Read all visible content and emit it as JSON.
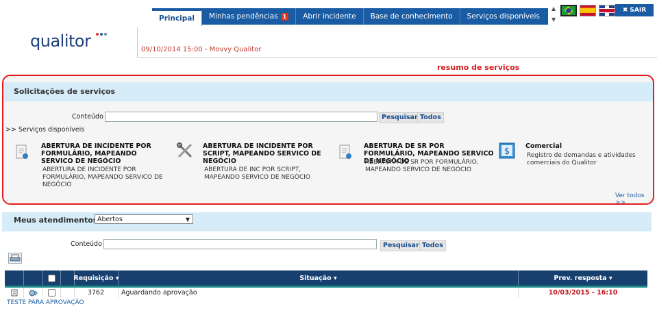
{
  "brand": {
    "logo_text": "qualitor"
  },
  "nav": {
    "tabs": [
      {
        "label": "Principal",
        "active": true
      },
      {
        "label": "Minhas pendências",
        "badge": "1"
      },
      {
        "label": "Abrir incidente"
      },
      {
        "label": "Base de conhecimento"
      },
      {
        "label": "Serviços disponíveis"
      }
    ],
    "sair_label": "SAIR",
    "flags": [
      "brazil-flag-icon",
      "spain-flag-icon",
      "uk-flag-icon"
    ]
  },
  "news": {
    "text": "09/10/2014 15:00 - Movvy Qualitor"
  },
  "annotation": "resumo de serviços",
  "services": {
    "title": "Solicitações de serviços",
    "search_label": "Conteúdo :",
    "search_value": "",
    "search_button": "Pesquisar",
    "all_button": "Todos",
    "available_link": ">> Serviços disponíveis",
    "items": [
      {
        "icon": "form-icon",
        "title": "ABERTURA DE INCIDENTE POR FORMULÁRIO, MAPEANDO SERVICO DE NEGÓCIO",
        "desc": "ABERTURA DE INCIDENTE POR FORMULÁRIO, MAPEANDO SERVICO DE NEGÓCIO"
      },
      {
        "icon": "tools-icon",
        "title": "ABERTURA DE INCIDENTE POR SCRIPT, MAPEANDO SERVICO DE NEGÓCIO",
        "desc": "ABERTURA DE INC POR SCRIPT, MAPEANDO SERVICO DE NEGÓCIO"
      },
      {
        "icon": "form-icon",
        "title": "ABERTURA DE SR POR FORMULÁRIO, MAPEANDO SERVICO DE NEGÓCIO",
        "desc": "ABERTURA DE SR POR FORMULÁRIO, MAPEANDO SERVICO DE NEGÓCIO"
      },
      {
        "icon": "dollar-icon",
        "title": "Comercial",
        "desc": "Registro de demandas e atividades comerciais do Qualitor"
      }
    ],
    "see_all": "Ver todos >>"
  },
  "atendimentos": {
    "title": "Meus atendimentos :",
    "filter_value": "Abertos",
    "search_label": "Conteúdo :",
    "search_value": "",
    "search_button": "Pesquisar",
    "all_button": "Todos",
    "table": {
      "headers": [
        "Requisição",
        "Situação",
        "Prev. resposta"
      ],
      "rows": [
        {
          "requisicao": "3762",
          "situacao": "Aguardando aprovação",
          "prev_resposta": "10/03/2015 - 16:10",
          "subject": "TESTE PARA APROVAÇÃO"
        }
      ]
    }
  },
  "colors": {
    "accent": "#1a5ca4",
    "header_dark": "#17406f",
    "highlight": "#e21d1d",
    "band": "#d6ecf9"
  }
}
